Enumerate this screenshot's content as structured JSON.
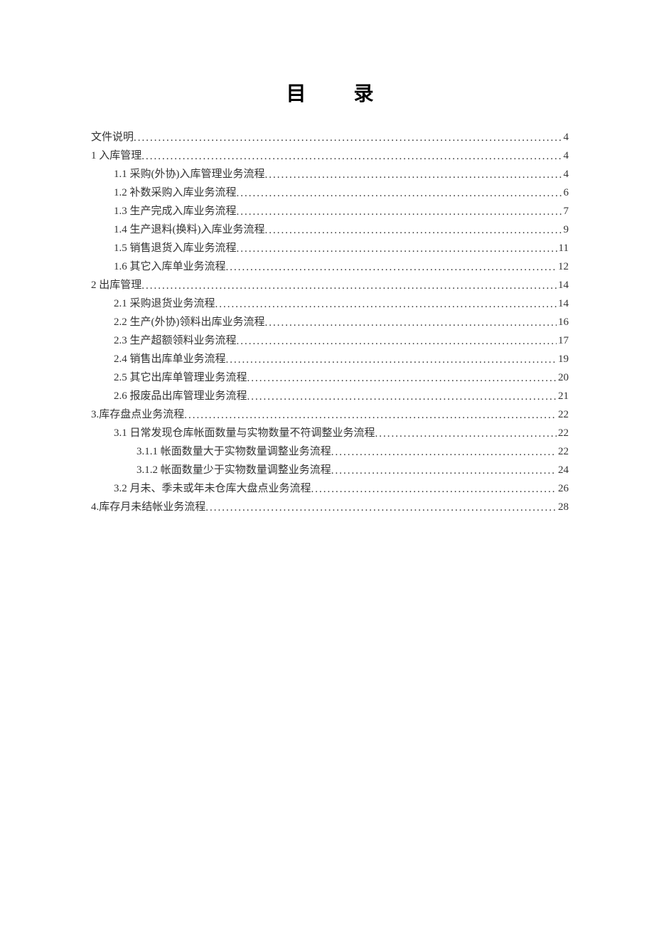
{
  "title": "目 录",
  "toc": [
    {
      "label": "文件说明",
      "page": "4",
      "level": 1
    },
    {
      "label": "1 入库管理",
      "page": "4",
      "level": 1
    },
    {
      "label": "1.1 采购(外协)入库管理业务流程",
      "page": "4",
      "level": 2
    },
    {
      "label": "1.2 补数采购入库业务流程",
      "page": "6",
      "level": 2
    },
    {
      "label": "1.3 生产完成入库业务流程",
      "page": "7",
      "level": 2
    },
    {
      "label": "1.4 生产退料(换料)入库业务流程",
      "page": "9",
      "level": 2
    },
    {
      "label": "1.5 销售退货入库业务流程",
      "page": "11",
      "level": 2
    },
    {
      "label": "1.6 其它入库单业务流程",
      "page": "12",
      "level": 2
    },
    {
      "label": "2 出库管理",
      "page": "14",
      "level": 1
    },
    {
      "label": "2.1 采购退货业务流程",
      "page": "14",
      "level": 2
    },
    {
      "label": "2.2 生产(外协)领料出库业务流程",
      "page": "16",
      "level": 2
    },
    {
      "label": "2.3 生产超额领料业务流程",
      "page": "17",
      "level": 2
    },
    {
      "label": "2.4 销售出库单业务流程",
      "page": "19",
      "level": 2
    },
    {
      "label": "2.5 其它出库单管理业务流程",
      "page": "20",
      "level": 2
    },
    {
      "label": "2.6 报废品出库管理业务流程",
      "page": "21",
      "level": 2
    },
    {
      "label": "3.库存盘点业务流程",
      "page": "22",
      "level": 1
    },
    {
      "label": "3.1 日常发现仓库帐面数量与实物数量不符调整业务流程",
      "page": "22",
      "level": 2
    },
    {
      "label": "3.1.1 帐面数量大于实物数量调整业务流程",
      "page": "22",
      "level": 3
    },
    {
      "label": "3.1.2 帐面数量少于实物数量调整业务流程",
      "page": "24",
      "level": 3
    },
    {
      "label": "3.2 月未、季未或年未仓库大盘点业务流程",
      "page": "26",
      "level": 2
    },
    {
      "label": "4.库存月未结帐业务流程",
      "page": "28",
      "level": 1
    }
  ]
}
